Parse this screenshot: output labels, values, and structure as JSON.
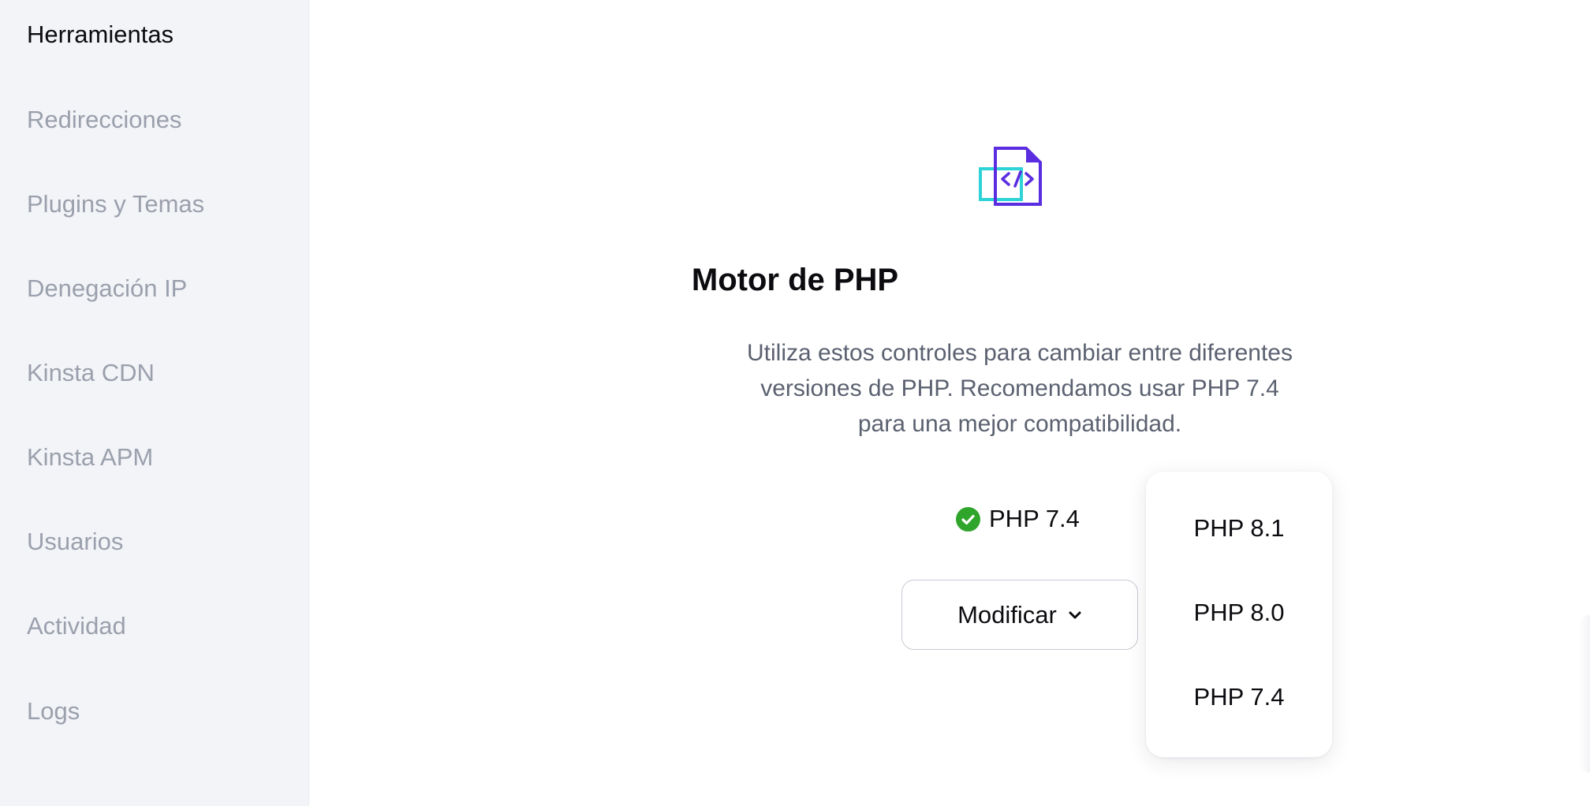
{
  "sidebar": {
    "items": [
      {
        "label": "Herramientas",
        "active": true
      },
      {
        "label": "Redirecciones",
        "active": false
      },
      {
        "label": "Plugins y Temas",
        "active": false
      },
      {
        "label": "Denegación IP",
        "active": false
      },
      {
        "label": "Kinsta CDN",
        "active": false
      },
      {
        "label": "Kinsta APM",
        "active": false
      },
      {
        "label": "Usuarios",
        "active": false
      },
      {
        "label": "Actividad",
        "active": false
      },
      {
        "label": "Logs",
        "active": false
      }
    ]
  },
  "main": {
    "icon": "php-code-file-icon",
    "title": "Motor de PHP",
    "description_lines": [
      "Utiliza estos controles para cambiar entre diferentes",
      "versiones de PHP. Recomendamos usar PHP 7.4",
      "para una mejor compatibilidad."
    ],
    "current_version": {
      "icon": "check-circle-icon",
      "label": "PHP 7.4"
    },
    "modify_button": {
      "label": "Modificar",
      "icon": "chevron-down-icon"
    },
    "dropdown": {
      "options": [
        "PHP 8.1",
        "PHP 8.0",
        "PHP 7.4"
      ]
    }
  },
  "colors": {
    "sidebar_bg": "#f3f4f8",
    "nav_inactive": "#9aa0ac",
    "nav_active": "#0c0c10",
    "accent_purple": "#5b2de0",
    "accent_teal": "#2ed3d8",
    "success_green": "#2fa52b",
    "description_text": "#5b6170"
  }
}
